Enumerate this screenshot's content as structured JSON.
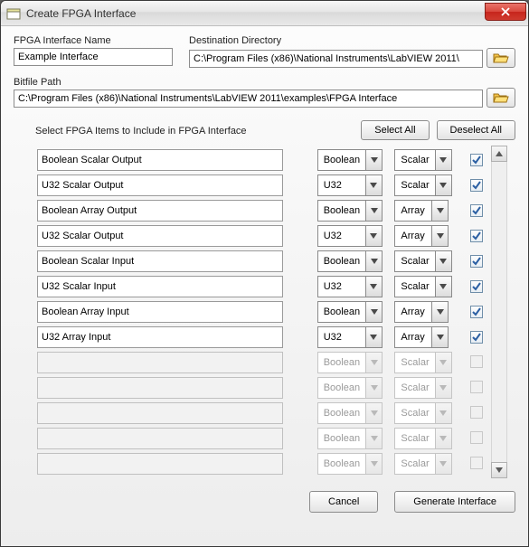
{
  "window": {
    "title": "Create FPGA Interface"
  },
  "fpga_name": {
    "label": "FPGA Interface Name",
    "value": "Example Interface"
  },
  "dest_dir": {
    "label": "Destination Directory",
    "value": "C:\\Program Files (x86)\\National Instruments\\LabVIEW 2011\\"
  },
  "bitfile": {
    "label": "Bitfile Path",
    "value": "C:\\Program Files (x86)\\National Instruments\\LabVIEW 2011\\examples\\FPGA Interface"
  },
  "items_section_label": "Select FPGA Items to Include in FPGA Interface",
  "buttons": {
    "select_all": "Select All",
    "deselect_all": "Deselect All",
    "cancel": "Cancel",
    "generate": "Generate Interface"
  },
  "defaults": {
    "type": "Boolean",
    "kind": "Scalar"
  },
  "rows": [
    {
      "name": "Boolean Scalar Output",
      "type": "Boolean",
      "kind": "Scalar",
      "checked": true,
      "enabled": true
    },
    {
      "name": "U32 Scalar Output",
      "type": "U32",
      "kind": "Scalar",
      "checked": true,
      "enabled": true
    },
    {
      "name": "Boolean Array Output",
      "type": "Boolean",
      "kind": "Array",
      "checked": true,
      "enabled": true
    },
    {
      "name": "U32 Scalar Output",
      "type": "U32",
      "kind": "Array",
      "checked": true,
      "enabled": true
    },
    {
      "name": "Boolean Scalar Input",
      "type": "Boolean",
      "kind": "Scalar",
      "checked": true,
      "enabled": true
    },
    {
      "name": "U32 Scalar Input",
      "type": "U32",
      "kind": "Scalar",
      "checked": true,
      "enabled": true
    },
    {
      "name": "Boolean Array Input",
      "type": "Boolean",
      "kind": "Array",
      "checked": true,
      "enabled": true
    },
    {
      "name": "U32 Array Input",
      "type": "U32",
      "kind": "Array",
      "checked": true,
      "enabled": true
    },
    {
      "name": "",
      "type": "Boolean",
      "kind": "Scalar",
      "checked": false,
      "enabled": false
    },
    {
      "name": "",
      "type": "Boolean",
      "kind": "Scalar",
      "checked": false,
      "enabled": false
    },
    {
      "name": "",
      "type": "Boolean",
      "kind": "Scalar",
      "checked": false,
      "enabled": false
    },
    {
      "name": "",
      "type": "Boolean",
      "kind": "Scalar",
      "checked": false,
      "enabled": false
    },
    {
      "name": "",
      "type": "Boolean",
      "kind": "Scalar",
      "checked": false,
      "enabled": false
    }
  ]
}
